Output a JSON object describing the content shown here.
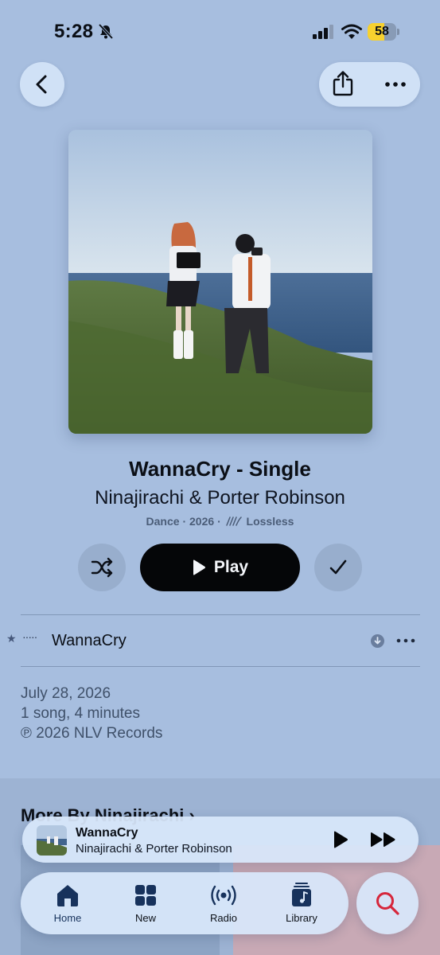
{
  "status_bar": {
    "time": "5:28",
    "battery_level": "58",
    "battery_fraction": 0.58,
    "icons": [
      "bell-slash-icon",
      "cellular-signal-icon",
      "wifi-icon",
      "battery-icon"
    ]
  },
  "nav": {
    "back_icon": "chevron-left-icon",
    "share_icon": "share-icon",
    "more_icon": "ellipsis-icon"
  },
  "album": {
    "title": "WannaCry - Single",
    "artist": "Ninajirachi & Porter Robinson",
    "genre": "Dance",
    "sep1": "·",
    "year": "2026",
    "sep2": "·",
    "quality": "Lossless"
  },
  "controls": {
    "shuffle_icon": "shuffle-icon",
    "play_label": "Play",
    "added_icon": "checkmark-icon"
  },
  "tracks": [
    {
      "title": "WannaCry",
      "marker": "★",
      "dots": "·····",
      "downloaded": true
    }
  ],
  "release": {
    "date": "July 28, 2026",
    "count": "1 song, 4 minutes",
    "copyright": "℗ 2026 NLV Records"
  },
  "more": {
    "title": "More By Ninajirachi",
    "chevron": "›"
  },
  "mini_player": {
    "title": "WannaCry",
    "artist": "Ninajirachi & Porter Robinson"
  },
  "tabs": [
    {
      "label": "Home",
      "icon": "home-icon",
      "selected": true
    },
    {
      "label": "New",
      "icon": "grid-icon",
      "selected": false
    },
    {
      "label": "Radio",
      "icon": "radio-icon",
      "selected": false
    },
    {
      "label": "Library",
      "icon": "library-icon",
      "selected": false
    }
  ],
  "search": {
    "icon": "search-icon"
  },
  "colors": {
    "background": "#a7bedf",
    "accent": "#d6263b",
    "battery": "#f7d12e"
  }
}
